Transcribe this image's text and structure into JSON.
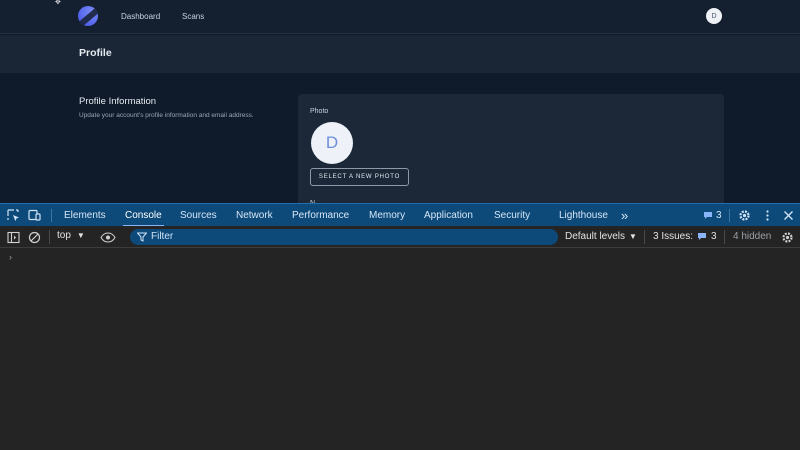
{
  "app": {
    "nav": {
      "dashboard": "Dashboard",
      "scans": "Scans",
      "user_initial": "D"
    },
    "page_title": "Profile",
    "section": {
      "title": "Profile Information",
      "description": "Update your account's profile information and email address."
    },
    "card": {
      "photo_label": "Photo",
      "avatar_initial": "D",
      "select_photo_button": "SELECT A NEW PHOTO",
      "name_label_partial": "N"
    }
  },
  "devtools": {
    "tabs": [
      "Elements",
      "Console",
      "Sources",
      "Network",
      "Performance",
      "Memory",
      "Application",
      "Security",
      "Lighthouse"
    ],
    "active_tab": "Console",
    "more_tabs": "»",
    "issues_badge_count": "3",
    "toolbar": {
      "context": "top",
      "filter_placeholder": "Filter",
      "levels": "Default levels",
      "issues_label": "3 Issues:",
      "issues_count": "3",
      "hidden": "4 hidden"
    },
    "console_prompt": "›"
  },
  "colors": {
    "devtools_tabbar": "#0d4a7a",
    "active_tab_indicator": "#8ab4f8",
    "app_background": "#0f1a2a",
    "card_background": "#1c2837"
  }
}
